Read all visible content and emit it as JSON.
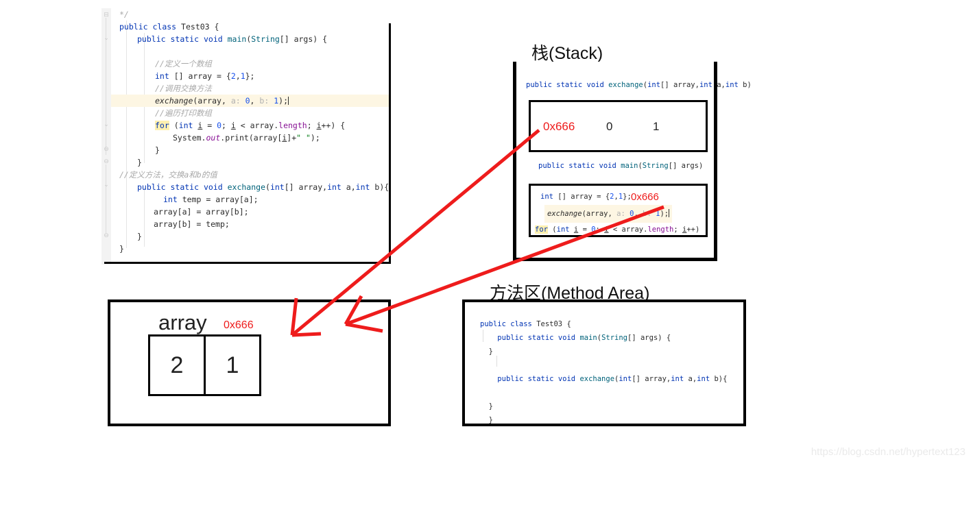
{
  "watermark": "https://blog.csdn.net/hypertext123",
  "editor": {
    "lines": [
      "*/",
      "public class Test03 {",
      "public static void main(String[] args) {",
      "",
      "//定义一个数组",
      "int [] array = {2,1};",
      "//调用交换方法",
      "exchange(array, a: 0, b: 1);",
      "//遍历打印数组",
      "for (int i = 0; i < array.length; i++) {",
      "System.out.print(array[i]+\" \");",
      "}",
      "}",
      "//定义方法，交换a和b的值",
      "public static void exchange(int[] array,int a,int b){",
      "int temp = array[a];",
      "array[a] = array[b];",
      "array[b] = temp;",
      "}",
      "}"
    ],
    "tokens": {
      "comment_end": "*/",
      "kw_public": "public",
      "kw_class": "class",
      "type_test03": "Test03",
      "kw_static": "static",
      "kw_void": "void",
      "mth_main": "main",
      "type_string": "String",
      "arg_args": "args",
      "cmt_define_array": "//定义一个数组",
      "kw_int": "int",
      "var_array": "array",
      "num_2": "2",
      "num_1": "1",
      "cmt_call_exchange": "//调用交换方法",
      "mth_exchange": "exchange",
      "hint_a": "a:",
      "hint_b": "b:",
      "num_0": "0",
      "cmt_loop_print": "//遍历打印数组",
      "kw_for": "for",
      "var_i": "i",
      "fld_length": "length",
      "sys_System": "System",
      "sys_out": "out",
      "sys_print": "print",
      "str_space": "\" \"",
      "cmt_define_method": "//定义方法，交换a和b的值",
      "var_temp": "temp",
      "var_a": "a",
      "var_b": "b"
    }
  },
  "stack": {
    "title": "栈(Stack)",
    "frames": [
      {
        "signature": "public static void exchange(int[] array,int a,int b)",
        "slots": [
          "0x666",
          "0",
          "1"
        ]
      },
      {
        "signature": "public static void main(String[] args)",
        "code_line1": "int [] array = {2,1};",
        "code_line1_addr": "0x666",
        "code_line2": "exchange(array, a: 0, b: 1);",
        "code_line3": "for (int i = 0; i < array.length; i++)"
      }
    ]
  },
  "method_area": {
    "title": "方法区(Method Area)",
    "lines": [
      "public class Test03 {",
      "public static void main(String[] args) {",
      "}",
      "public static void exchange(int[] array,int a,int b){",
      "}",
      "}"
    ]
  },
  "heap": {
    "array_label": "array",
    "address": "0x666",
    "cells": [
      "2",
      "1"
    ]
  },
  "colors": {
    "red": "#ee1c1c",
    "keyword_blue": "#0033b3",
    "comment_gray": "#a8a8a8",
    "field_purple": "#871094",
    "method_teal": "#00627a",
    "highlight_line": "#fdf6e3",
    "highlight_keyword": "#fdf0b0",
    "outline_black": "#000000"
  }
}
